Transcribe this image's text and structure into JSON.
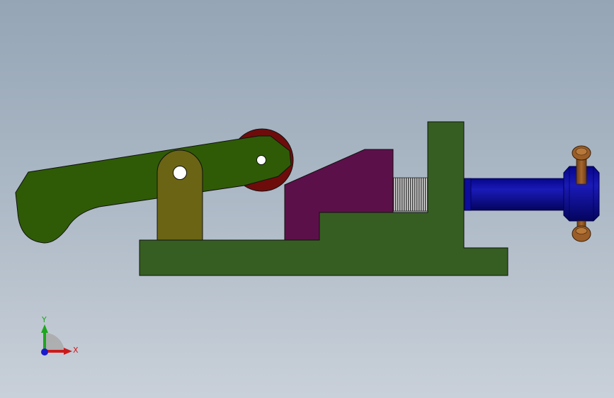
{
  "viewport": {
    "background_top": "#95a5b6",
    "background_bottom": "#c9d0d9"
  },
  "parts": {
    "base_color": "#375e22",
    "lever_color": "#2f5b06",
    "support_color": "#6b6414",
    "roller_color": "#6e0c0c",
    "jaw_color": "#5c1049",
    "screw_color": "#c8c8c8",
    "knob_color": "#10109a",
    "handle_color": "#8a5423"
  },
  "triad": {
    "x_label": "X",
    "y_label": "Y",
    "x_color": "#cc1a1a",
    "y_color": "#1ea61e",
    "z_color": "#1a1acc"
  }
}
